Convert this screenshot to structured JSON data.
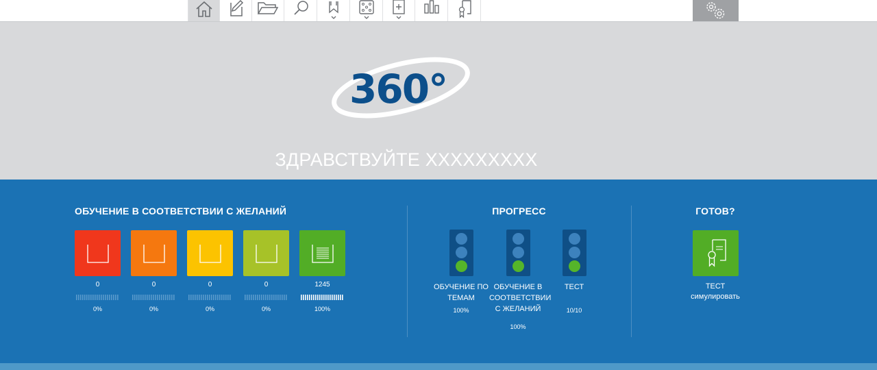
{
  "toolbar": {
    "items": [
      {
        "icon": "home-icon",
        "active": true
      },
      {
        "icon": "edit-icon",
        "active": false
      },
      {
        "icon": "folder-icon",
        "active": false
      },
      {
        "icon": "search-icon",
        "active": false
      },
      {
        "icon": "bookmark-dropdown-icon",
        "active": false
      },
      {
        "icon": "dice-dropdown-icon",
        "active": false
      },
      {
        "icon": "add-document-dropdown-icon",
        "active": false
      },
      {
        "icon": "bar-chart-icon",
        "active": false
      },
      {
        "icon": "certificate-icon",
        "active": false
      }
    ],
    "settings_icon": "gears-icon"
  },
  "hero": {
    "logo_text": "360°",
    "greeting": "ЗДРАВСТВУЙТЕ XXXXXXXXX"
  },
  "learning": {
    "title": "ОБУЧЕНИЕ В СООТВЕТСТВИИ С ЖЕЛАНИЙ",
    "tiles": [
      {
        "color": "#f0371c",
        "count": "0",
        "percent": "0%",
        "progress": 0
      },
      {
        "color": "#f5780f",
        "count": "0",
        "percent": "0%",
        "progress": 0
      },
      {
        "color": "#fcc300",
        "count": "0",
        "percent": "0%",
        "progress": 0
      },
      {
        "color": "#a7c228",
        "count": "0",
        "percent": "0%",
        "progress": 0
      },
      {
        "color": "#52ad26",
        "count": "1245",
        "percent": "100%",
        "progress": 1
      }
    ]
  },
  "progress": {
    "title": "ПРОГРЕСС",
    "items": [
      {
        "label": "ОБУЧЕНИЕ ПО ТЕМАМ",
        "value": "100%",
        "lit_lamp": 3
      },
      {
        "label": "ОБУЧЕНИЕ В СООТВЕТСТВИИ С ЖЕЛАНИЙ",
        "value": "100%",
        "lit_lamp": 3
      },
      {
        "label": "ТЕСТ",
        "value": "10/10",
        "lit_lamp": 3
      }
    ]
  },
  "ready": {
    "title": "ГОТОВ?",
    "label_line1": "ТЕСТ",
    "label_line2": "симулировать"
  },
  "colors": {
    "panel_blue": "#1b72b4",
    "hero_gray": "#d8d9db",
    "logo_blue": "#0c4f8b",
    "lamp_on": "#55b52a"
  }
}
